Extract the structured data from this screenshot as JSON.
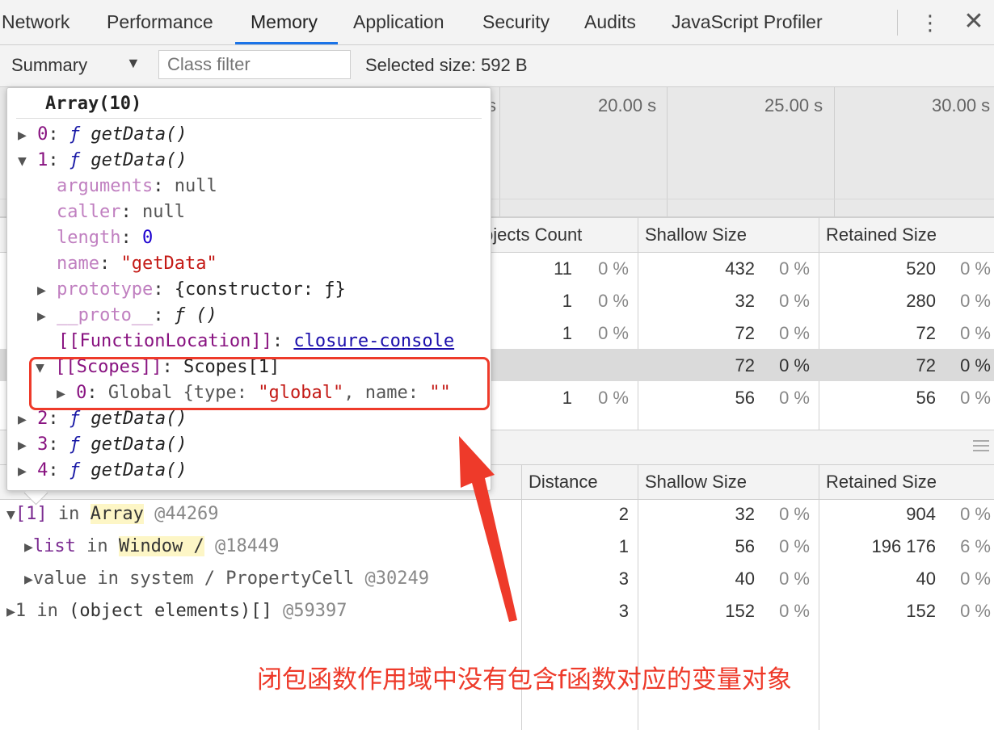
{
  "tabs": [
    "Network",
    "Performance",
    "Memory",
    "Application",
    "Security",
    "Audits",
    "JavaScript Profiler"
  ],
  "toolbar": {
    "view": "Summary",
    "class_filter_placeholder": "Class filter",
    "selected_size": "Selected size: 592 B"
  },
  "timeline_labels": [
    "s",
    "20.00 s",
    "25.00 s",
    "30.00 s"
  ],
  "constructors_table": {
    "headers": [
      "bjects Count",
      "Shallow Size",
      "Retained Size"
    ],
    "rows": [
      {
        "count": "11",
        "count_pct": "0 %",
        "shallow": "432",
        "shallow_pct": "0 %",
        "retained": "520",
        "retained_pct": "0 %"
      },
      {
        "count": "1",
        "count_pct": "0 %",
        "shallow": "32",
        "shallow_pct": "0 %",
        "retained": "280",
        "retained_pct": "0 %"
      },
      {
        "count": "1",
        "count_pct": "0 %",
        "shallow": "72",
        "shallow_pct": "0 %",
        "retained": "72",
        "retained_pct": "0 %"
      },
      {
        "count": "",
        "count_pct": "",
        "shallow": "72",
        "shallow_pct": "0 %",
        "retained": "72",
        "retained_pct": "0 %"
      },
      {
        "count": "1",
        "count_pct": "0 %",
        "shallow": "56",
        "shallow_pct": "0 %",
        "retained": "56",
        "retained_pct": "0 %"
      }
    ]
  },
  "retainers_table": {
    "headers": [
      "Distance",
      "Shallow Size",
      "Retained Size"
    ],
    "rows": [
      {
        "name": "[1]",
        "kw": "in",
        "obj": "Array",
        "addr": "@44269",
        "distance": "2",
        "shallow": "32",
        "shallow_pct": "0 %",
        "retained": "904",
        "retained_pct": "0 %"
      },
      {
        "name": "list",
        "kw": "in",
        "obj": "Window /",
        "addr": "@18449",
        "distance": "1",
        "shallow": "56",
        "shallow_pct": "0 %",
        "retained": "196 176",
        "retained_pct": "6 %"
      },
      {
        "name": "value",
        "kw": "in",
        "obj": "system / PropertyCell",
        "addr": "@30249",
        "distance": "3",
        "shallow": "40",
        "shallow_pct": "0 %",
        "retained": "40",
        "retained_pct": "0 %"
      },
      {
        "name": "1",
        "kw": "in",
        "obj": "(object elements)[]",
        "addr": "@59397",
        "distance": "3",
        "shallow": "152",
        "shallow_pct": "0 %",
        "retained": "152",
        "retained_pct": "0 %"
      }
    ]
  },
  "popover": {
    "title": "Array(10)",
    "item0_idx": "0",
    "item1_idx": "1",
    "fn_sym": "ƒ",
    "fn_name": "getData()",
    "arguments_key": "arguments",
    "arguments_val": "null",
    "caller_key": "caller",
    "caller_val": "null",
    "length_key": "length",
    "length_val": "0",
    "name_key": "name",
    "name_val": "\"getData\"",
    "prototype_key": "prototype",
    "prototype_val": "{constructor: ƒ}",
    "proto_key": "__proto__",
    "proto_val": "ƒ ()",
    "fnloc_key": "[[FunctionLocation]]",
    "fnloc_val": "closure-console",
    "scopes_key": "[[Scopes]]",
    "scopes_val": "Scopes[1]",
    "scope0_idx": "0",
    "scope0_val_a": "Global {type: ",
    "scope0_type": "\"global\"",
    "scope0_val_b": ", name: ",
    "scope0_name": "\"\"",
    "item2_idx": "2",
    "item3_idx": "3",
    "item4_idx": "4"
  },
  "annotation": "闭包函数作用域中没有包含f函数对应的变量对象",
  "colors": {
    "annotation": "#ee3a2a",
    "tab_active": "#1a73e8"
  }
}
